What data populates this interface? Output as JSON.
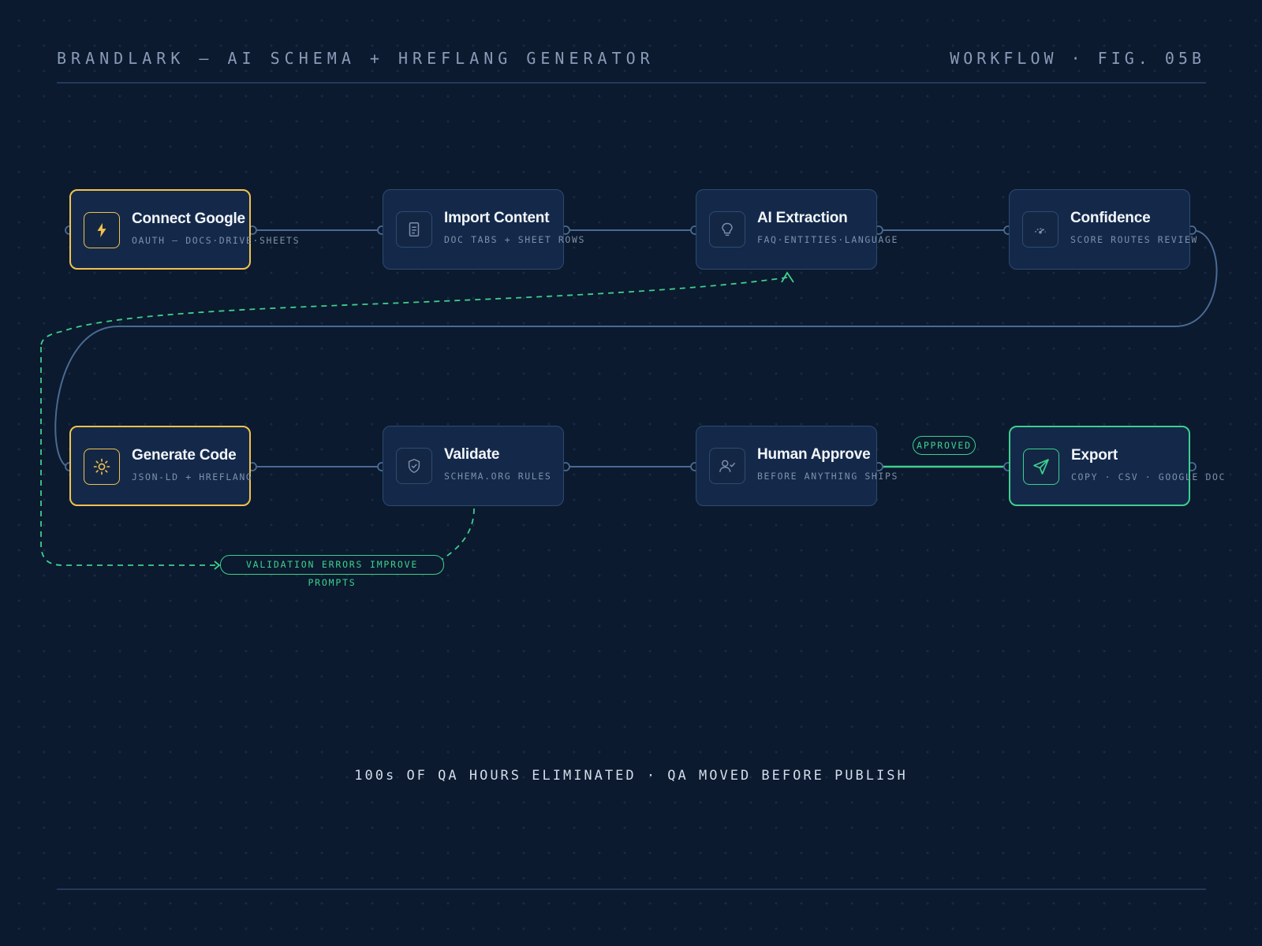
{
  "header": {
    "title": "BRANDLARK — AI SCHEMA + HREFLANG GENERATOR",
    "figure": "WORKFLOW · FIG. 05B"
  },
  "nodes": [
    {
      "title": "Connect Google",
      "subtitle": "OAUTH — DOCS·DRIVE·SHEETS",
      "icon": "lightning-bolt-icon",
      "accent": "#f2c14e"
    },
    {
      "title": "Import Content",
      "subtitle": "DOC TABS + SHEET ROWS",
      "icon": "document-icon"
    },
    {
      "title": "AI Extraction",
      "subtitle": "FAQ·ENTITIES·LANGUAGE",
      "icon": "lightbulb-icon"
    },
    {
      "title": "Confidence",
      "subtitle": "SCORE ROUTES REVIEW",
      "icon": "gauge-icon"
    },
    {
      "title": "Generate Code",
      "subtitle": "JSON-LD + HREFLANG",
      "icon": "sun-gear-icon",
      "accent": "#f2c14e"
    },
    {
      "title": "Validate",
      "subtitle": "SCHEMA.ORG RULES",
      "icon": "shield-check-icon"
    },
    {
      "title": "Human Approve",
      "subtitle": "BEFORE ANYTHING SHIPS",
      "icon": "user-check-icon"
    },
    {
      "title": "Export",
      "subtitle": "COPY · CSV · GOOGLE DOC",
      "icon": "send-icon",
      "accent": "#3ecf8e"
    }
  ],
  "edge_labels": {
    "approved": "APPROVED",
    "feedback": "VALIDATION ERRORS IMPROVE PROMPTS"
  },
  "footer": {
    "tagline": "100s OF QA HOURS ELIMINATED · QA MOVED BEFORE PUBLISH"
  },
  "colors": {
    "background": "#0b1a2e",
    "node_fill": "#14294a",
    "edge": "#4a6a94",
    "accent_yellow": "#f2c14e",
    "accent_green": "#3ecf8e"
  }
}
